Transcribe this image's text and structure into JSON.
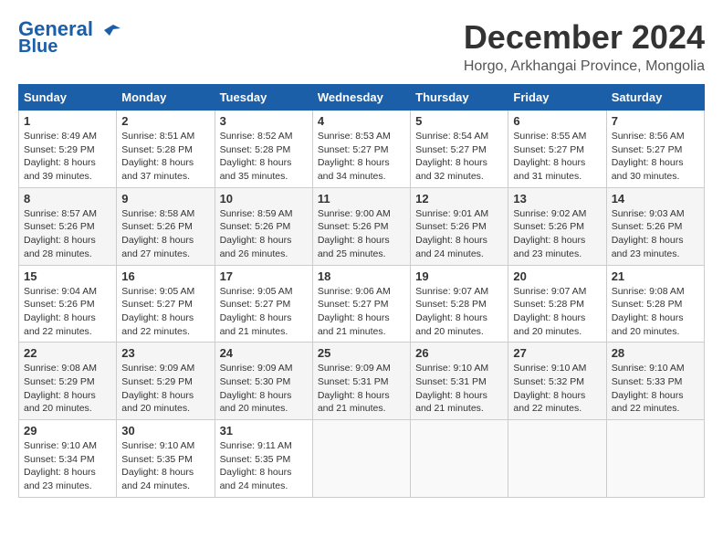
{
  "header": {
    "logo_line1": "General",
    "logo_line2": "Blue",
    "month_title": "December 2024",
    "location": "Horgo, Arkhangai Province, Mongolia"
  },
  "calendar": {
    "days_of_week": [
      "Sunday",
      "Monday",
      "Tuesday",
      "Wednesday",
      "Thursday",
      "Friday",
      "Saturday"
    ],
    "weeks": [
      [
        {
          "day": "",
          "empty": true
        },
        {
          "day": "",
          "empty": true
        },
        {
          "day": "",
          "empty": true
        },
        {
          "day": "",
          "empty": true
        },
        {
          "day": "",
          "empty": true
        },
        {
          "day": "",
          "empty": true
        },
        {
          "day": "",
          "empty": true
        }
      ],
      [
        {
          "day": "1",
          "sunrise": "Sunrise: 8:49 AM",
          "sunset": "Sunset: 5:29 PM",
          "daylight": "Daylight: 8 hours and 39 minutes."
        },
        {
          "day": "2",
          "sunrise": "Sunrise: 8:51 AM",
          "sunset": "Sunset: 5:28 PM",
          "daylight": "Daylight: 8 hours and 37 minutes."
        },
        {
          "day": "3",
          "sunrise": "Sunrise: 8:52 AM",
          "sunset": "Sunset: 5:28 PM",
          "daylight": "Daylight: 8 hours and 35 minutes."
        },
        {
          "day": "4",
          "sunrise": "Sunrise: 8:53 AM",
          "sunset": "Sunset: 5:27 PM",
          "daylight": "Daylight: 8 hours and 34 minutes."
        },
        {
          "day": "5",
          "sunrise": "Sunrise: 8:54 AM",
          "sunset": "Sunset: 5:27 PM",
          "daylight": "Daylight: 8 hours and 32 minutes."
        },
        {
          "day": "6",
          "sunrise": "Sunrise: 8:55 AM",
          "sunset": "Sunset: 5:27 PM",
          "daylight": "Daylight: 8 hours and 31 minutes."
        },
        {
          "day": "7",
          "sunrise": "Sunrise: 8:56 AM",
          "sunset": "Sunset: 5:27 PM",
          "daylight": "Daylight: 8 hours and 30 minutes."
        }
      ],
      [
        {
          "day": "8",
          "sunrise": "Sunrise: 8:57 AM",
          "sunset": "Sunset: 5:26 PM",
          "daylight": "Daylight: 8 hours and 28 minutes."
        },
        {
          "day": "9",
          "sunrise": "Sunrise: 8:58 AM",
          "sunset": "Sunset: 5:26 PM",
          "daylight": "Daylight: 8 hours and 27 minutes."
        },
        {
          "day": "10",
          "sunrise": "Sunrise: 8:59 AM",
          "sunset": "Sunset: 5:26 PM",
          "daylight": "Daylight: 8 hours and 26 minutes."
        },
        {
          "day": "11",
          "sunrise": "Sunrise: 9:00 AM",
          "sunset": "Sunset: 5:26 PM",
          "daylight": "Daylight: 8 hours and 25 minutes."
        },
        {
          "day": "12",
          "sunrise": "Sunrise: 9:01 AM",
          "sunset": "Sunset: 5:26 PM",
          "daylight": "Daylight: 8 hours and 24 minutes."
        },
        {
          "day": "13",
          "sunrise": "Sunrise: 9:02 AM",
          "sunset": "Sunset: 5:26 PM",
          "daylight": "Daylight: 8 hours and 23 minutes."
        },
        {
          "day": "14",
          "sunrise": "Sunrise: 9:03 AM",
          "sunset": "Sunset: 5:26 PM",
          "daylight": "Daylight: 8 hours and 23 minutes."
        }
      ],
      [
        {
          "day": "15",
          "sunrise": "Sunrise: 9:04 AM",
          "sunset": "Sunset: 5:26 PM",
          "daylight": "Daylight: 8 hours and 22 minutes."
        },
        {
          "day": "16",
          "sunrise": "Sunrise: 9:05 AM",
          "sunset": "Sunset: 5:27 PM",
          "daylight": "Daylight: 8 hours and 22 minutes."
        },
        {
          "day": "17",
          "sunrise": "Sunrise: 9:05 AM",
          "sunset": "Sunset: 5:27 PM",
          "daylight": "Daylight: 8 hours and 21 minutes."
        },
        {
          "day": "18",
          "sunrise": "Sunrise: 9:06 AM",
          "sunset": "Sunset: 5:27 PM",
          "daylight": "Daylight: 8 hours and 21 minutes."
        },
        {
          "day": "19",
          "sunrise": "Sunrise: 9:07 AM",
          "sunset": "Sunset: 5:28 PM",
          "daylight": "Daylight: 8 hours and 20 minutes."
        },
        {
          "day": "20",
          "sunrise": "Sunrise: 9:07 AM",
          "sunset": "Sunset: 5:28 PM",
          "daylight": "Daylight: 8 hours and 20 minutes."
        },
        {
          "day": "21",
          "sunrise": "Sunrise: 9:08 AM",
          "sunset": "Sunset: 5:28 PM",
          "daylight": "Daylight: 8 hours and 20 minutes."
        }
      ],
      [
        {
          "day": "22",
          "sunrise": "Sunrise: 9:08 AM",
          "sunset": "Sunset: 5:29 PM",
          "daylight": "Daylight: 8 hours and 20 minutes."
        },
        {
          "day": "23",
          "sunrise": "Sunrise: 9:09 AM",
          "sunset": "Sunset: 5:29 PM",
          "daylight": "Daylight: 8 hours and 20 minutes."
        },
        {
          "day": "24",
          "sunrise": "Sunrise: 9:09 AM",
          "sunset": "Sunset: 5:30 PM",
          "daylight": "Daylight: 8 hours and 20 minutes."
        },
        {
          "day": "25",
          "sunrise": "Sunrise: 9:09 AM",
          "sunset": "Sunset: 5:31 PM",
          "daylight": "Daylight: 8 hours and 21 minutes."
        },
        {
          "day": "26",
          "sunrise": "Sunrise: 9:10 AM",
          "sunset": "Sunset: 5:31 PM",
          "daylight": "Daylight: 8 hours and 21 minutes."
        },
        {
          "day": "27",
          "sunrise": "Sunrise: 9:10 AM",
          "sunset": "Sunset: 5:32 PM",
          "daylight": "Daylight: 8 hours and 22 minutes."
        },
        {
          "day": "28",
          "sunrise": "Sunrise: 9:10 AM",
          "sunset": "Sunset: 5:33 PM",
          "daylight": "Daylight: 8 hours and 22 minutes."
        }
      ],
      [
        {
          "day": "29",
          "sunrise": "Sunrise: 9:10 AM",
          "sunset": "Sunset: 5:34 PM",
          "daylight": "Daylight: 8 hours and 23 minutes."
        },
        {
          "day": "30",
          "sunrise": "Sunrise: 9:10 AM",
          "sunset": "Sunset: 5:35 PM",
          "daylight": "Daylight: 8 hours and 24 minutes."
        },
        {
          "day": "31",
          "sunrise": "Sunrise: 9:11 AM",
          "sunset": "Sunset: 5:35 PM",
          "daylight": "Daylight: 8 hours and 24 minutes."
        },
        {
          "day": "",
          "empty": true
        },
        {
          "day": "",
          "empty": true
        },
        {
          "day": "",
          "empty": true
        },
        {
          "day": "",
          "empty": true
        }
      ]
    ]
  }
}
